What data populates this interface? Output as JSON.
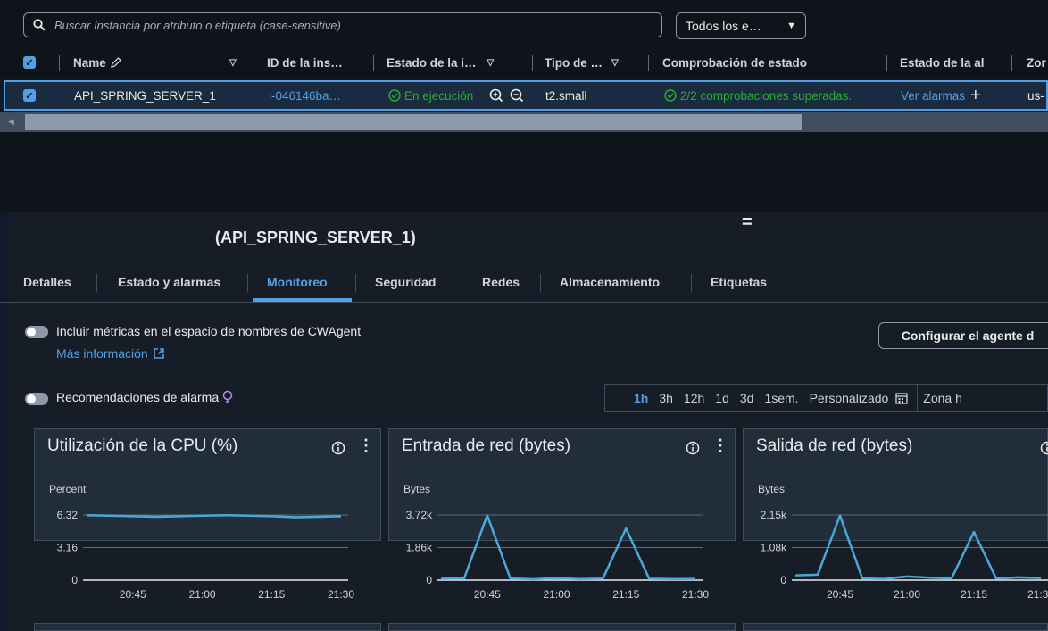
{
  "search": {
    "placeholder": "Buscar Instancia por atributo o etiqueta (case-sensitive)",
    "filter_label": "Todos los e…"
  },
  "table": {
    "headers": [
      "Name",
      "ID de la ins…",
      "Estado de la i…",
      "Tipo de …",
      "Comprobación de estado",
      "Estado de la al",
      "Zor"
    ],
    "row": {
      "name": "API_SPRING_SERVER_1",
      "id": "i-046146ba…",
      "state": "En ejecución",
      "type": "t2.small",
      "check": "2/2 comprobaciones superadas.",
      "alarm": "Ver alarmas",
      "zone": "us-"
    }
  },
  "details": {
    "resize_handle": "=",
    "title": "(API_SPRING_SERVER_1)",
    "tabs": [
      "Detalles",
      "Estado y alarmas",
      "Monitoreo",
      "Seguridad",
      "Redes",
      "Almacenamiento",
      "Etiquetas"
    ],
    "active_tab": "Monitoreo",
    "cwagent_label": "Incluir métricas en el espacio de nombres de CWAgent",
    "more_info": "Más información",
    "configure_button": "Configurar el agente d",
    "alarm_recs_label": "Recomendaciones de alarma",
    "ranges": [
      "1h",
      "3h",
      "12h",
      "1d",
      "3d",
      "1sem.",
      "Personalizado"
    ],
    "active_range": "1h",
    "timezone": "Zona h"
  },
  "colors": {
    "accent": "#539fe5",
    "success": "#29ad32",
    "line": "#4aa8d8"
  },
  "chart_data": [
    {
      "type": "line",
      "title": "Utilización de la CPU (%)",
      "ylabel": "Percent",
      "ylim": [
        0,
        6.32
      ],
      "yticks": [
        "6.32",
        "3.16",
        "0"
      ],
      "xticks": [
        "20:45",
        "21:00",
        "21:15",
        "21:30"
      ],
      "x": [
        "20:35",
        "20:40",
        "20:45",
        "20:50",
        "20:55",
        "21:00",
        "21:05",
        "21:10",
        "21:15",
        "21:20",
        "21:25",
        "21:30"
      ],
      "series": [
        {
          "values": [
            6.3,
            6.25,
            6.2,
            6.15,
            6.2,
            6.25,
            6.3,
            6.25,
            6.2,
            6.1,
            6.15,
            6.2
          ]
        }
      ]
    },
    {
      "type": "line",
      "title": "Entrada de red (bytes)",
      "ylabel": "Bytes",
      "ylim": [
        0,
        3720
      ],
      "yticks": [
        "3.72k",
        "1.86k",
        "0"
      ],
      "xticks": [
        "20:45",
        "21:00",
        "21:15",
        "21:30"
      ],
      "x": [
        "20:35",
        "20:40",
        "20:45",
        "20:50",
        "20:55",
        "21:00",
        "21:05",
        "21:10",
        "21:15",
        "21:20",
        "21:25",
        "21:30"
      ],
      "series": [
        {
          "values": [
            80,
            90,
            3700,
            100,
            50,
            120,
            60,
            90,
            2950,
            80,
            60,
            70
          ]
        }
      ]
    },
    {
      "type": "line",
      "title": "Salida de red (bytes)",
      "ylabel": "Bytes",
      "ylim": [
        0,
        2150
      ],
      "yticks": [
        "2.15k",
        "1.08k",
        "0"
      ],
      "xticks": [
        "20:45",
        "21:00",
        "21:15",
        "21:30"
      ],
      "x": [
        "20:35",
        "20:40",
        "20:45",
        "20:50",
        "20:55",
        "21:00",
        "21:05",
        "21:10",
        "21:15",
        "21:20",
        "21:25",
        "21:30"
      ],
      "series": [
        {
          "values": [
            160,
            180,
            2130,
            60,
            40,
            120,
            80,
            60,
            1590,
            50,
            90,
            70
          ]
        }
      ]
    }
  ]
}
